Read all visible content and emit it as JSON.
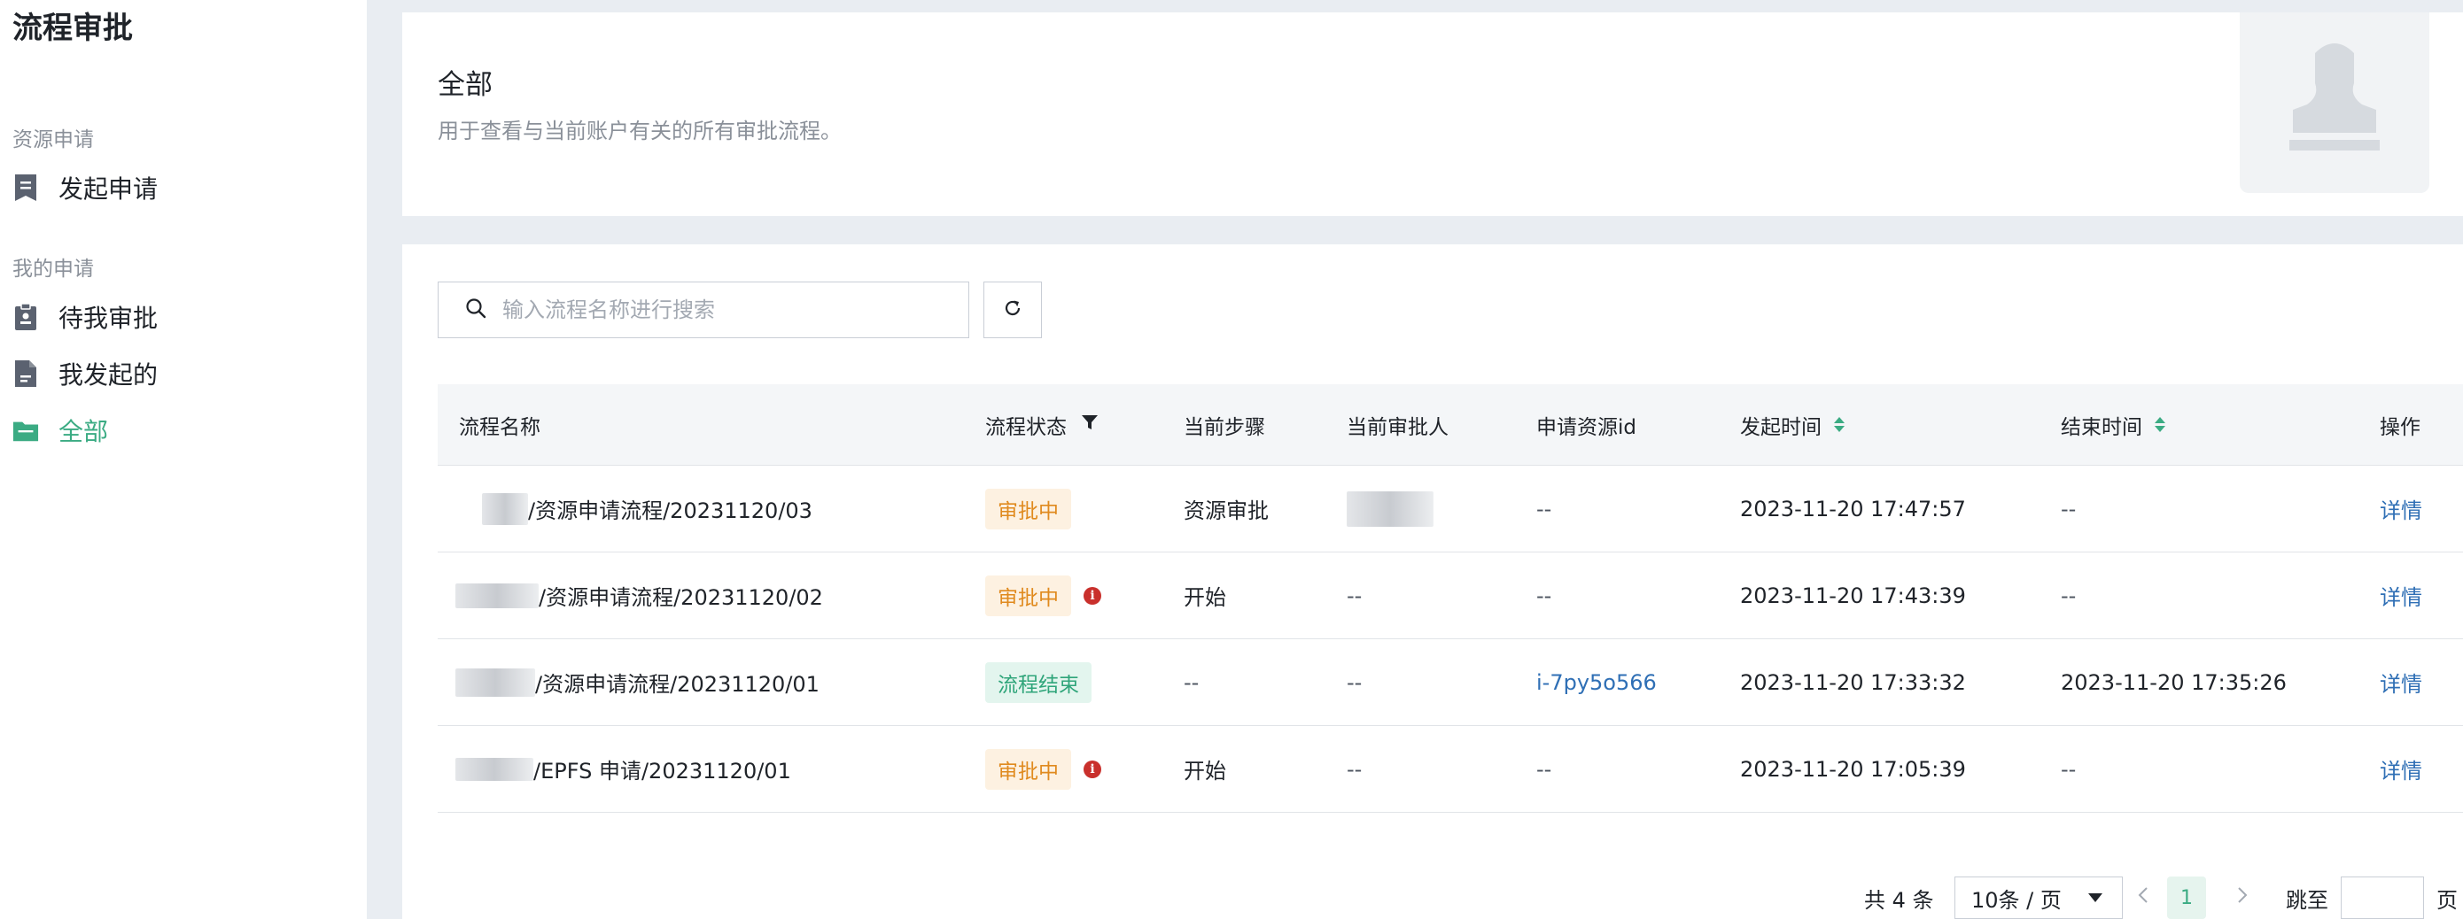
{
  "sidebar": {
    "title": "流程审批",
    "group1": "资源申请",
    "group2": "我的申请",
    "items": [
      {
        "label": "发起申请",
        "icon": "document-icon"
      },
      {
        "label": "待我审批",
        "icon": "clipboard-icon"
      },
      {
        "label": "我发起的",
        "icon": "file-icon"
      },
      {
        "label": "全部",
        "icon": "folder-icon"
      }
    ],
    "active_color": "#3bab83"
  },
  "header": {
    "title": "全部",
    "description": "用于查看与当前账户有关的所有审批流程。"
  },
  "search": {
    "placeholder": "输入流程名称进行搜索"
  },
  "table": {
    "columns": [
      "流程名称",
      "流程状态",
      "当前步骤",
      "当前审批人",
      "申请资源id",
      "发起时间",
      "结束时间",
      "操作"
    ],
    "rows": [
      {
        "name": "/资源申请流程/20231120/03",
        "status": "审批中",
        "step": "资源审批",
        "approver": "",
        "resource_id": "--",
        "start": "2023-11-20 17:47:57",
        "end": "--",
        "action": "详情"
      },
      {
        "name": "/资源申请流程/20231120/02",
        "status": "审批中",
        "step": "开始",
        "approver": "--",
        "resource_id": "--",
        "start": "2023-11-20 17:43:39",
        "end": "--",
        "action": "详情"
      },
      {
        "name": "/资源申请流程/20231120/01",
        "status": "流程结束",
        "step": "--",
        "approver": "--",
        "resource_id": "i-7py5o566",
        "start": "2023-11-20 17:33:32",
        "end": "2023-11-20 17:35:26",
        "action": "详情"
      },
      {
        "name": "/EPFS 申请/20231120/01",
        "status": "审批中",
        "step": "开始",
        "approver": "--",
        "resource_id": "--",
        "start": "2023-11-20 17:05:39",
        "end": "--",
        "action": "详情"
      }
    ]
  },
  "pagination": {
    "total": "共 4 条",
    "page_size": "10条 / 页",
    "current_page": "1",
    "goto_label": "跳至",
    "page_suffix": "页"
  },
  "colors": {
    "accent": "#3bab83",
    "pending": "#e08a1e",
    "done": "#2fa57a",
    "link": "#2f6fb5"
  }
}
